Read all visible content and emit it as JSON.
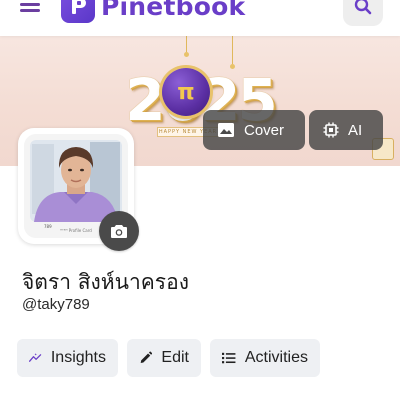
{
  "header": {
    "app_name": "Pinetbook",
    "brand_color": "#6a3ec8",
    "menu_icon": "hamburger-menu-icon",
    "search_icon": "search-icon"
  },
  "cover": {
    "year_text": "2025",
    "pi_symbol": "π",
    "banner_text": "HAPPY NEW YEAR",
    "cover_button_label": "Cover",
    "ai_button_label": "AI"
  },
  "avatar": {
    "caption": "ᴴᵀᴮᴹ Profile Card",
    "id_text": "789"
  },
  "profile": {
    "display_name": "จิตรา สิงห์นาครอง",
    "username": "@taky789"
  },
  "actions": {
    "insights_label": "Insights",
    "edit_label": "Edit",
    "activities_label": "Activities"
  }
}
